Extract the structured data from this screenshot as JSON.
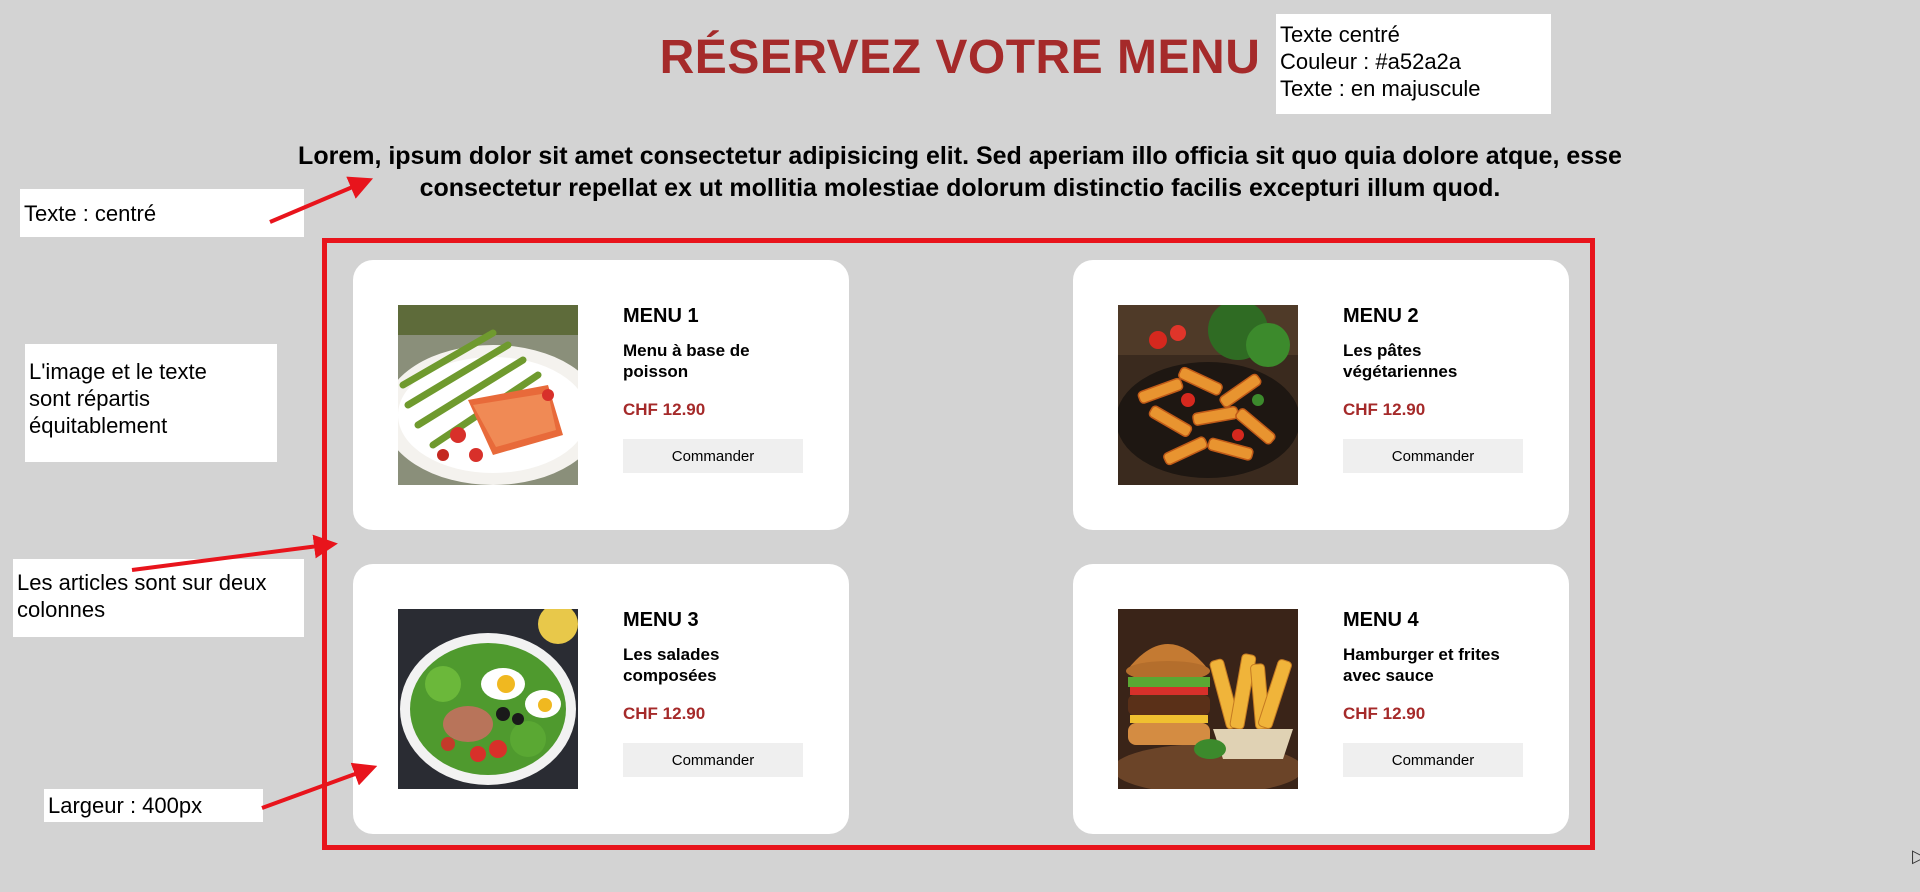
{
  "page": {
    "title": "RÉSERVEZ VOTRE MENU",
    "intro": "Lorem, ipsum dolor sit amet consectetur adipisicing elit. Sed aperiam illo officia sit quo quia dolore atque, esse consectetur repellat ex ut mollitia molestiae dolorum distinctio facilis excepturi illum quod.",
    "accent_color": "#a52a2a",
    "frame_color": "#e8141c"
  },
  "notes": {
    "title_note": [
      "Texte centré",
      "Couleur : #a52a2a",
      "Texte : en majuscule"
    ],
    "intro_note": "Texte : centré",
    "layout_note": [
      "L'image et le texte",
      "sont répartis",
      "équitablement"
    ],
    "columns_note": [
      "Les articles sont sur deux",
      "colonnes"
    ],
    "width_note": "Largeur : 400px"
  },
  "menus": [
    {
      "name": "MENU 1",
      "description": "Menu à base de poisson",
      "price": "CHF 12.90",
      "button": "Commander",
      "image": "salmon-asparagus-photo"
    },
    {
      "name": "MENU 2",
      "description": "Les pâtes végétariennes",
      "price": "CHF 12.90",
      "button": "Commander",
      "image": "penne-pasta-photo"
    },
    {
      "name": "MENU 3",
      "description": "Les salades composées",
      "price": "CHF 12.90",
      "button": "Commander",
      "image": "mixed-salad-photo"
    },
    {
      "name": "MENU 4",
      "description": "Hamburger et frites avec sauce",
      "price": "CHF 12.90",
      "button": "Commander",
      "image": "burger-fries-photo"
    }
  ]
}
